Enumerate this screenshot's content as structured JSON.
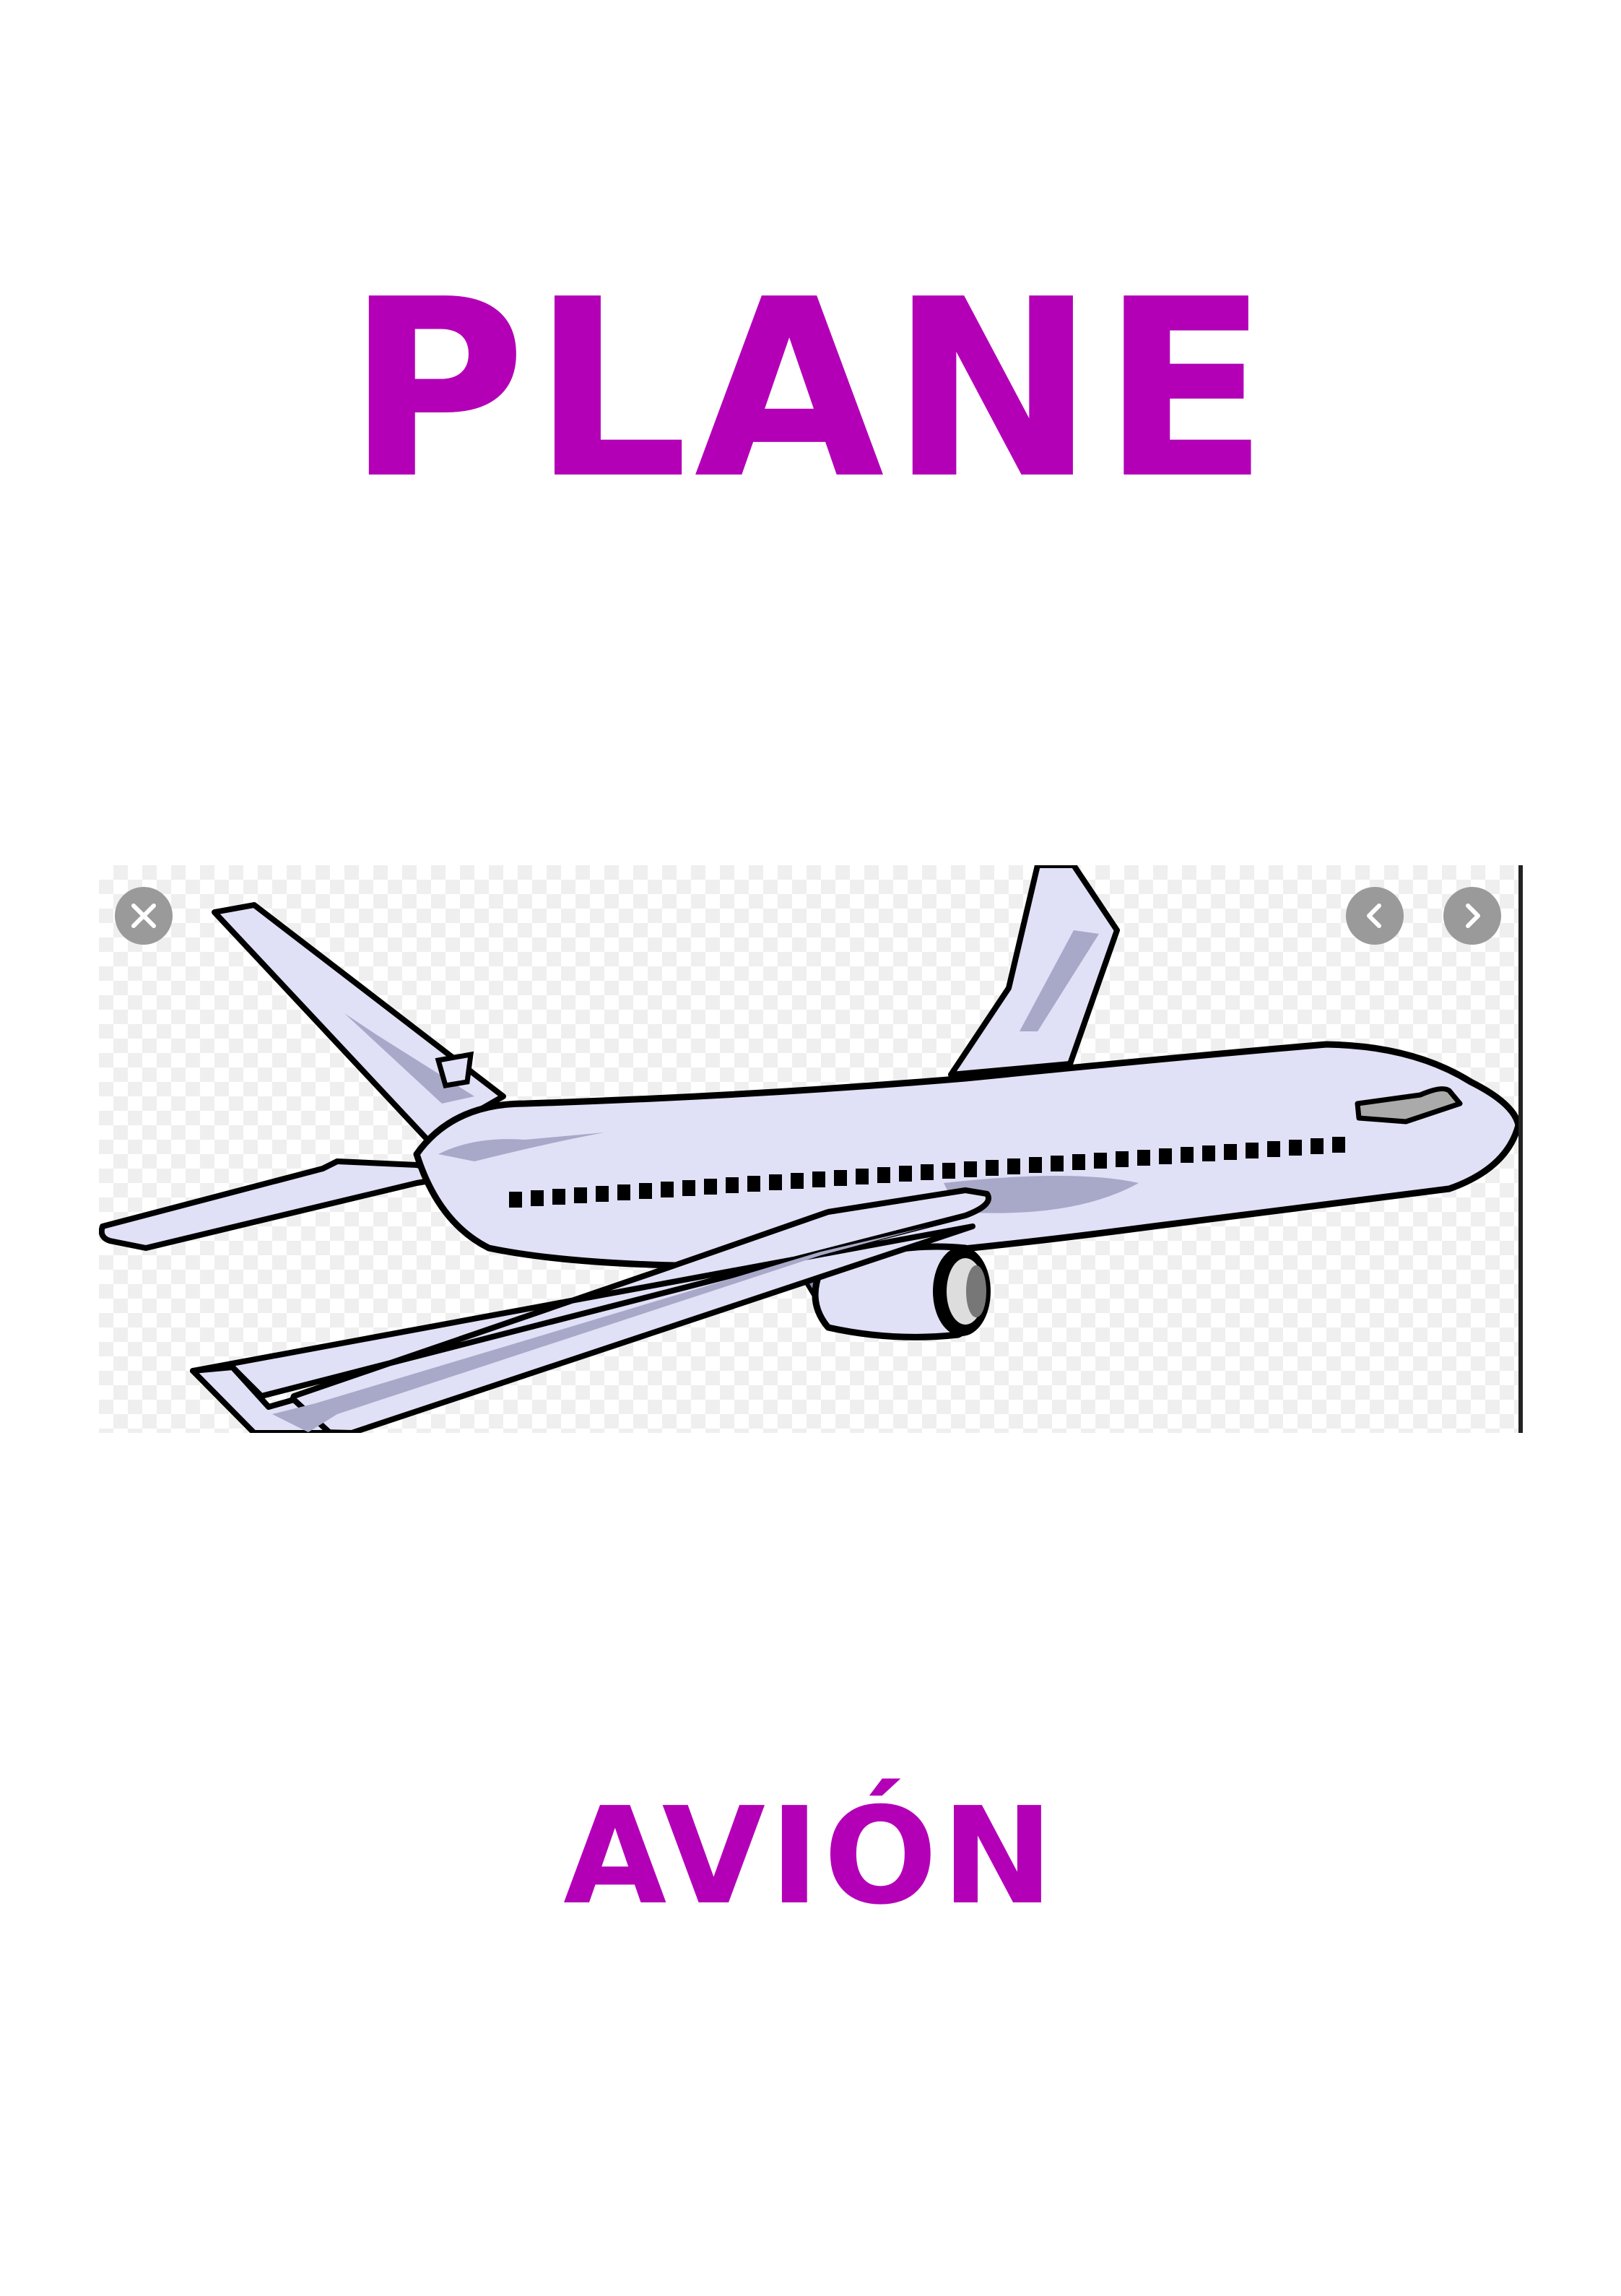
{
  "card": {
    "english_word": "PLANE",
    "spanish_word": "AVIÓN"
  },
  "image_viewer": {
    "close_icon": "close-icon",
    "prev_icon": "chevron-left-icon",
    "next_icon": "chevron-right-icon",
    "illustration": "airplane-illustration"
  },
  "colors": {
    "title": "#b300b7",
    "plane_body": "#e0e0f7",
    "plane_shadow": "#a8a8c8",
    "outline": "#000000",
    "button": "#9a9a9a"
  }
}
